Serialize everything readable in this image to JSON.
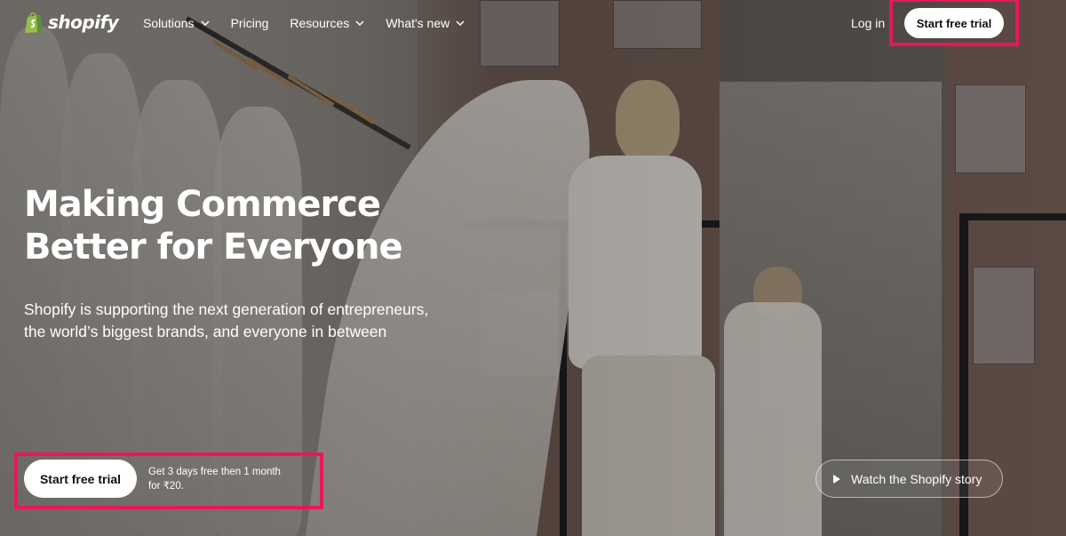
{
  "brand": {
    "logo_text": "shopify",
    "logo_color": "#95bf47"
  },
  "nav": {
    "items": [
      {
        "label": "Solutions",
        "has_dropdown": true
      },
      {
        "label": "Pricing",
        "has_dropdown": false
      },
      {
        "label": "Resources",
        "has_dropdown": true
      },
      {
        "label": "What's new",
        "has_dropdown": true
      }
    ],
    "login_label": "Log in",
    "cta_label": "Start free trial"
  },
  "hero": {
    "headline_line1": "Making Commerce",
    "headline_line2": "Better for Everyone",
    "subtext_line1": "Shopify is supporting the next generation of entrepreneurs,",
    "subtext_line2": "the world’s biggest brands, and everyone in between",
    "cta_label": "Start free trial",
    "cta_note_line1": "Get 3 days free then 1 month",
    "cta_note_line2": "for ₹20.",
    "watch_label": "Watch the Shopify story"
  },
  "colors": {
    "highlight_border": "#e8175d",
    "button_bg": "#ffffff",
    "button_text": "#111111"
  }
}
